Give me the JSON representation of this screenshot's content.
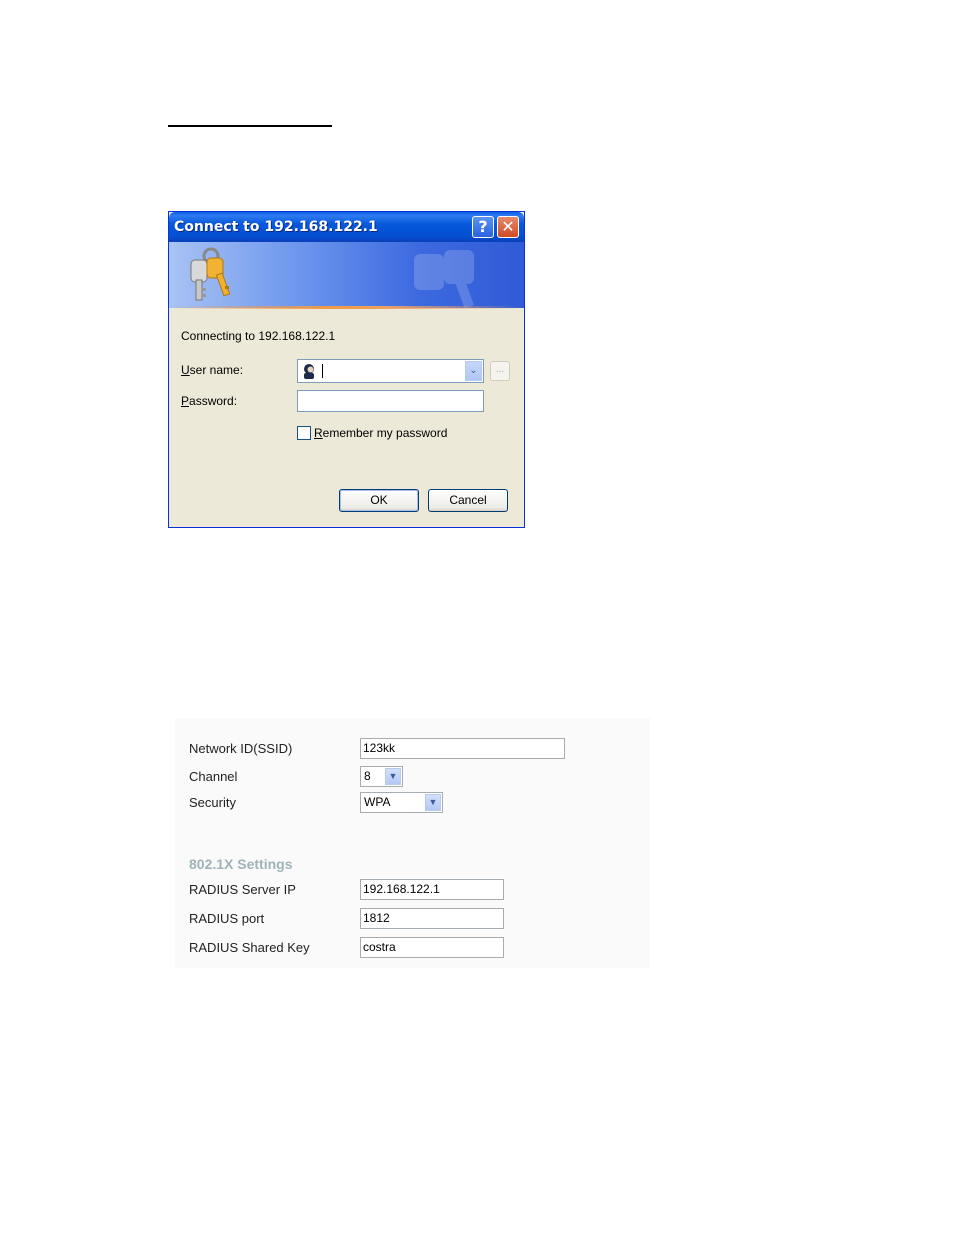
{
  "dialog": {
    "title": "Connect to 192.168.122.1",
    "help_label": "?",
    "close_label": "✕",
    "connecting_text": "Connecting to 192.168.122.1",
    "username_label_u": "U",
    "username_label_rest": "ser name:",
    "username_value": "",
    "password_label_u": "P",
    "password_label_rest": "assword:",
    "password_value": "",
    "browse_label": "...",
    "dropdown_arrow": "⌄",
    "remember_u": "R",
    "remember_rest": "emember my password",
    "remember_checked": false,
    "ok_label": "OK",
    "cancel_label": "Cancel"
  },
  "settings": {
    "rows": [
      {
        "label": "Network ID(SSID)",
        "value": "123kk"
      },
      {
        "label": "Channel",
        "value": "8"
      },
      {
        "label": "Security",
        "value": "WPA"
      }
    ],
    "section_title": "802.1X Settings",
    "radius": [
      {
        "label": "RADIUS Server IP",
        "value": "192.168.122.1"
      },
      {
        "label": "RADIUS port",
        "value": "1812"
      },
      {
        "label": "RADIUS Shared Key",
        "value": "costra"
      }
    ],
    "select_arrow": "▼"
  },
  "colors": {
    "titlebar": "#0450d2",
    "dialog_bg": "#ece9d8",
    "section_title": "#9fb3b8"
  }
}
